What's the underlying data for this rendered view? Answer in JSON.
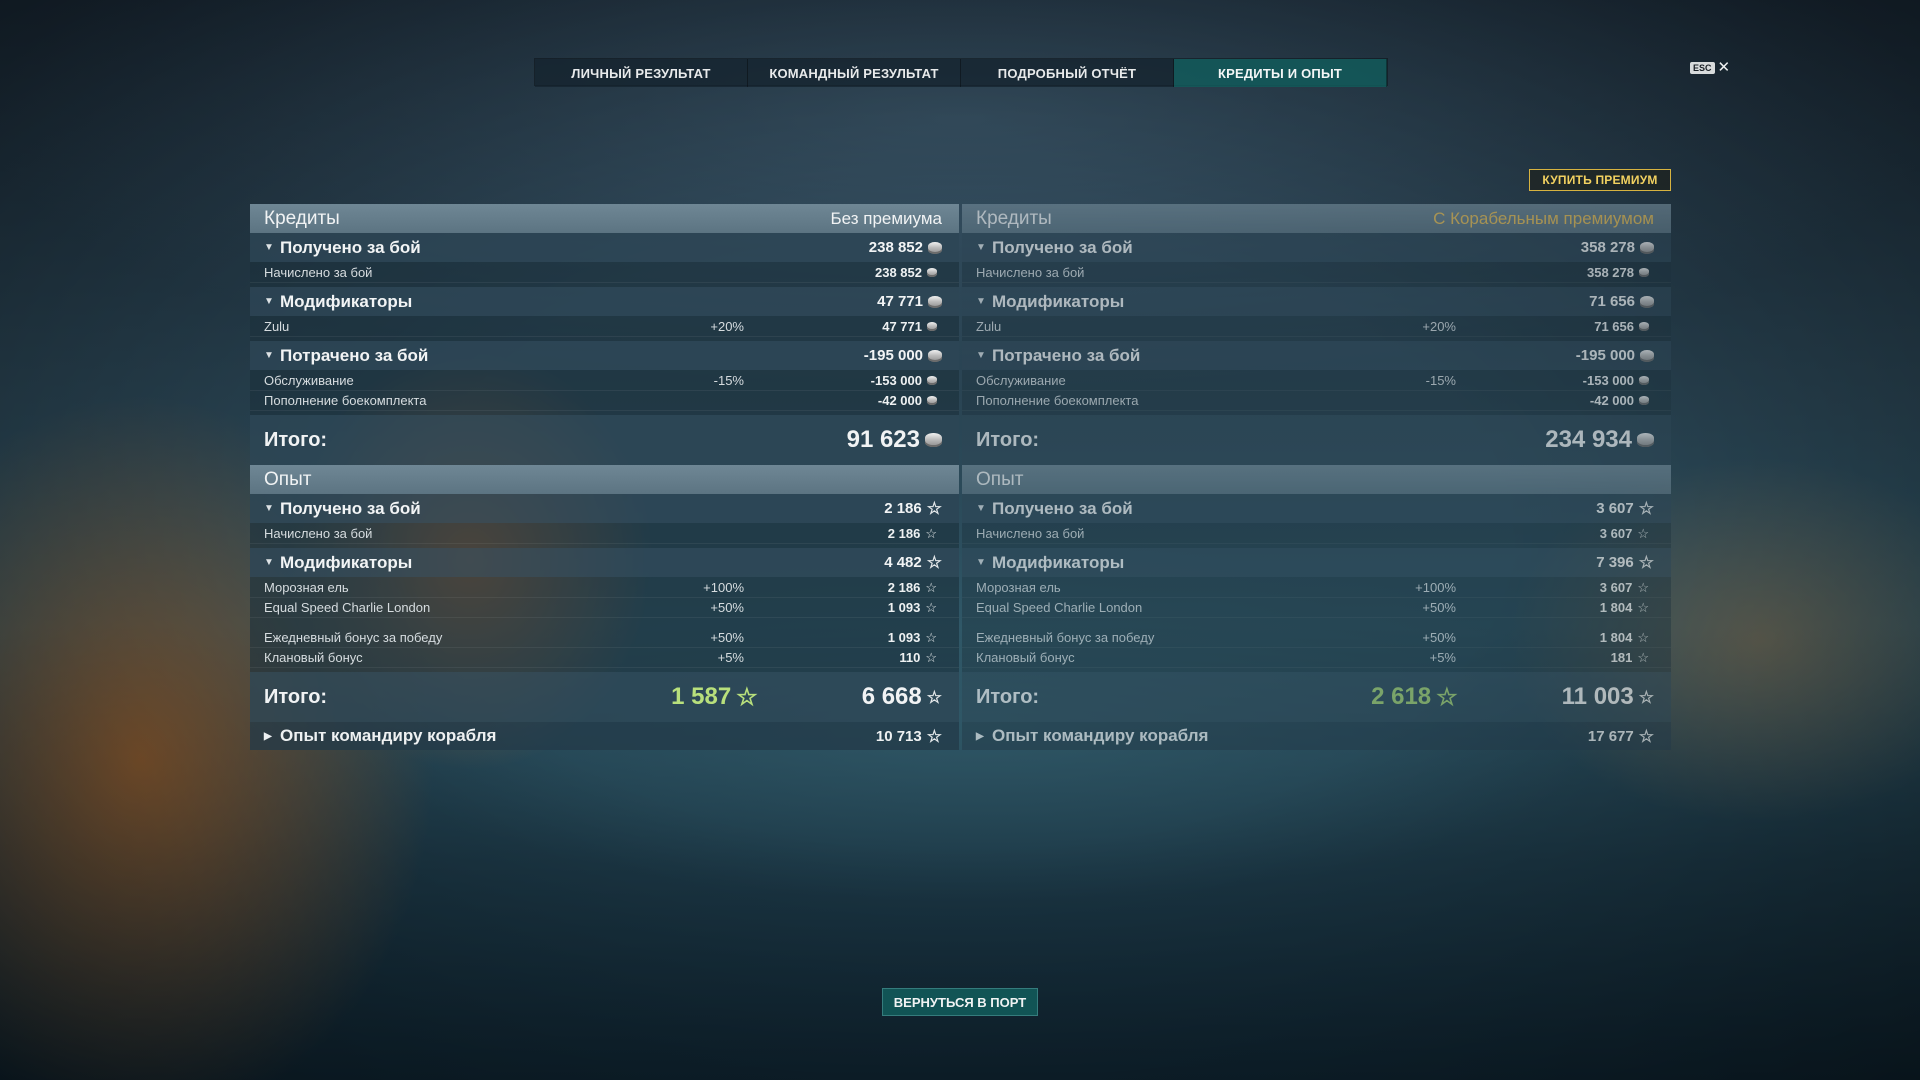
{
  "tabs": [
    "ЛИЧНЫЙ РЕЗУЛЬТАТ",
    "КОМАНДНЫЙ РЕЗУЛЬТАТ",
    "ПОДРОБНЫЙ ОТЧЁТ",
    "КРЕДИТЫ И ОПЫТ"
  ],
  "active_tab": "КРЕДИТЫ И ОПЫТ",
  "esc_label": "ESC",
  "buy_premium": "КУПИТЬ ПРЕМИУМ",
  "back_to_port": "ВЕРНУТЬСЯ В ПОРТ",
  "colors": {
    "accent_teal": "#125a5a",
    "premium_gold": "#e9c05a",
    "free_xp_green": "#b8e07c"
  },
  "left": {
    "credits": {
      "title": "Кредиты",
      "subtitle": "Без премиума",
      "earned": {
        "label": "Получено за бой",
        "value": "238 852",
        "rows": [
          {
            "label": "Начислено за бой",
            "value": "238 852"
          }
        ]
      },
      "modifiers": {
        "label": "Модификаторы",
        "value": "47 771",
        "rows": [
          {
            "label": "Zulu",
            "pct": "+20%",
            "value": "47 771"
          }
        ]
      },
      "spent": {
        "label": "Потрачено за бой",
        "value": "-195 000",
        "rows": [
          {
            "label": "Обслуживание",
            "pct": "-15%",
            "value": "-153 000"
          },
          {
            "label": "Пополнение боекомплекта",
            "value": "-42 000"
          }
        ]
      },
      "total_label": "Итого:",
      "total": "91 623"
    },
    "xp": {
      "title": "Опыт",
      "earned": {
        "label": "Получено за бой",
        "value": "2 186",
        "rows": [
          {
            "label": "Начислено за бой",
            "value": "2 186"
          }
        ]
      },
      "modifiers": {
        "label": "Модификаторы",
        "value": "4 482",
        "rows": [
          {
            "label": "Морозная ель",
            "pct": "+100%",
            "value": "2 186"
          },
          {
            "label": "Equal Speed Charlie London",
            "pct": "+50%",
            "value": "1 093"
          },
          {
            "label": "Ежедневный бонус за победу",
            "pct": "+50%",
            "value": "1 093"
          },
          {
            "label": "Клановый бонус",
            "pct": "+5%",
            "value": "110"
          }
        ]
      },
      "total_label": "Итого:",
      "free_xp": "1 587",
      "total": "6 668",
      "commander": {
        "label": "Опыт командиру корабля",
        "value": "10 713"
      }
    }
  },
  "right": {
    "credits": {
      "title": "Кредиты",
      "subtitle": "С Корабельным премиумом",
      "earned": {
        "label": "Получено за бой",
        "value": "358 278",
        "rows": [
          {
            "label": "Начислено за бой",
            "value": "358 278"
          }
        ]
      },
      "modifiers": {
        "label": "Модификаторы",
        "value": "71 656",
        "rows": [
          {
            "label": "Zulu",
            "pct": "+20%",
            "value": "71 656"
          }
        ]
      },
      "spent": {
        "label": "Потрачено за бой",
        "value": "-195 000",
        "rows": [
          {
            "label": "Обслуживание",
            "pct": "-15%",
            "value": "-153 000"
          },
          {
            "label": "Пополнение боекомплекта",
            "value": "-42 000"
          }
        ]
      },
      "total_label": "Итого:",
      "total": "234 934"
    },
    "xp": {
      "title": "Опыт",
      "earned": {
        "label": "Получено за бой",
        "value": "3 607",
        "rows": [
          {
            "label": "Начислено за бой",
            "value": "3 607"
          }
        ]
      },
      "modifiers": {
        "label": "Модификаторы",
        "value": "7 396",
        "rows": [
          {
            "label": "Морозная ель",
            "pct": "+100%",
            "value": "3 607"
          },
          {
            "label": "Equal Speed Charlie London",
            "pct": "+50%",
            "value": "1 804"
          },
          {
            "label": "Ежедневный бонус за победу",
            "pct": "+50%",
            "value": "1 804"
          },
          {
            "label": "Клановый бонус",
            "pct": "+5%",
            "value": "181"
          }
        ]
      },
      "total_label": "Итого:",
      "free_xp": "2 618",
      "total": "11 003",
      "commander": {
        "label": "Опыт командиру корабля",
        "value": "17 677"
      }
    }
  }
}
